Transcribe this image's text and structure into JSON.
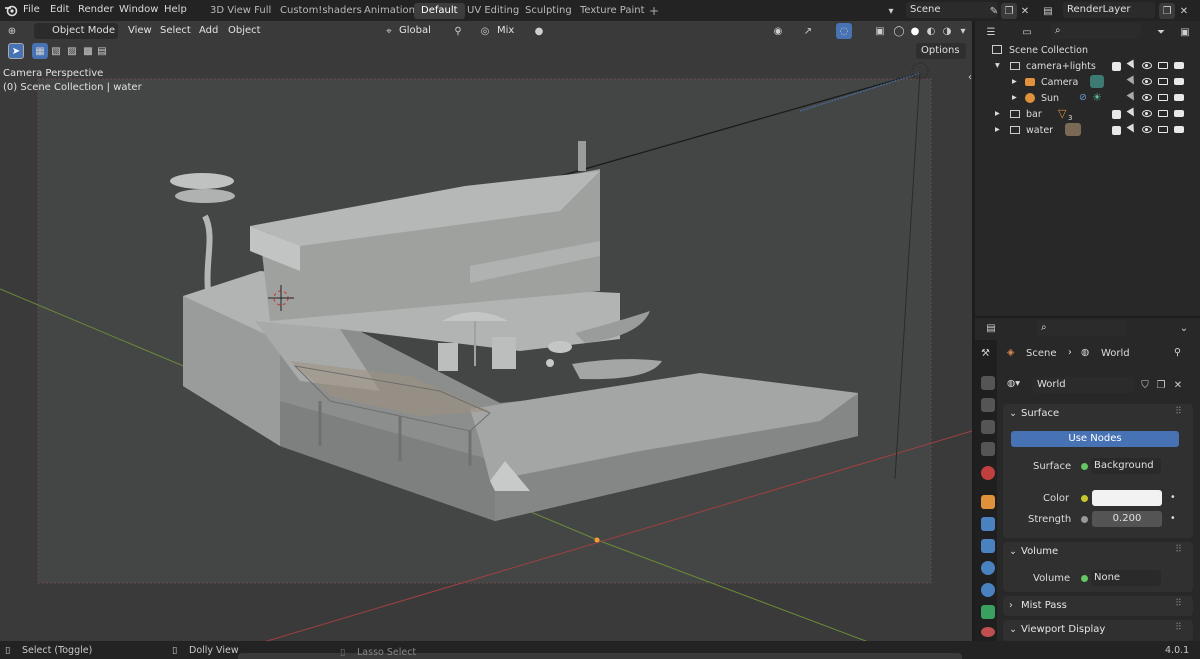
{
  "topbar": {
    "menus": [
      "File",
      "Edit",
      "Render",
      "Window",
      "Help"
    ],
    "workspaces": [
      "3D View Full",
      "Custom!shaders",
      "Animation",
      "Default",
      "UV Editing",
      "Sculpting",
      "Texture Paint"
    ],
    "active_workspace": "Default",
    "add_tab": "+",
    "scene_name": "Scene",
    "render_layer": "RenderLayer"
  },
  "viewport": {
    "mode": "Object Mode",
    "menus": [
      "View",
      "Select",
      "Add",
      "Object"
    ],
    "transform_orientation": "Global",
    "snap_mode": "Mix",
    "options_label": "Options",
    "perspective_label": "Camera Perspective",
    "collection_label": "(0) Scene Collection | water"
  },
  "outliner": {
    "root": "Scene Collection",
    "items": [
      {
        "label": "camera+lights"
      },
      {
        "label": "Camera"
      },
      {
        "label": "Sun"
      },
      {
        "label": "bar"
      },
      {
        "label": "water"
      }
    ],
    "bar_badge": "3"
  },
  "properties": {
    "breadcrumb_scene": "Scene",
    "breadcrumb_world": "World",
    "world_name": "World",
    "surface_panel": "Surface",
    "use_nodes_label": "Use Nodes",
    "surface_label": "Surface",
    "surface_value": "Background",
    "color_label": "Color",
    "strength_label": "Strength",
    "strength_value": "0.200",
    "volume_panel": "Volume",
    "volume_label": "Volume",
    "volume_value": "None",
    "mist_panel": "Mist Pass",
    "viewport_display_panel": "Viewport Display"
  },
  "statusbar": {
    "select_hint": "Select (Toggle)",
    "dolly_hint": "Dolly View",
    "lasso_hint": "Lasso Select",
    "version": "4.0.1"
  },
  "colors": {
    "accent": "#4772b3",
    "viewport_bg": "#3d3d3d",
    "panel_bg": "#303030",
    "socket_green": "#63c763",
    "socket_yellow": "#c7c729"
  }
}
